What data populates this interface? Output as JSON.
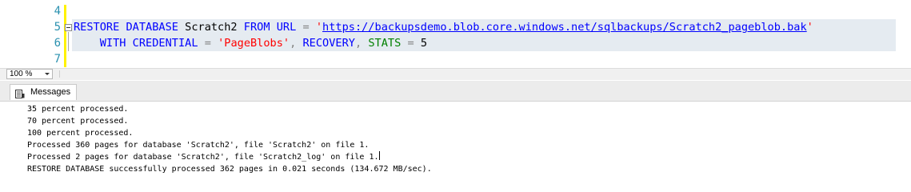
{
  "editor": {
    "line_numbers": [
      "4",
      "5",
      "6",
      "7"
    ],
    "line5": {
      "kw1": "RESTORE DATABASE",
      "ident": " Scratch2 ",
      "kw2": "FROM URL",
      "eq": " = ",
      "q1": "'",
      "url": "https://backupsdemo.blob.core.windows.net/sqlbackups/Scratch2_pageblob.bak",
      "q2": "'"
    },
    "line6": {
      "indent": "    ",
      "kw1": "WITH CREDENTIAL",
      "eq": " = ",
      "str": "'PageBlobs'",
      "comma1": ", ",
      "kw2": "RECOVERY",
      "comma2": ", ",
      "fn": "STATS",
      "eq2": " = ",
      "num": "5"
    }
  },
  "zoom": {
    "value": "100 %"
  },
  "results": {
    "tab_label": "Messages",
    "tab_icon": "messages-icon",
    "lines": [
      "35 percent processed.",
      "70 percent processed.",
      "100 percent processed.",
      "Processed 360 pages for database 'Scratch2', file 'Scratch2' on file 1.",
      "Processed 2 pages for database 'Scratch2', file 'Scratch2_log' on file 1.",
      "RESTORE DATABASE successfully processed 362 pages in 0.021 seconds (134.672 MB/sec)."
    ]
  }
}
